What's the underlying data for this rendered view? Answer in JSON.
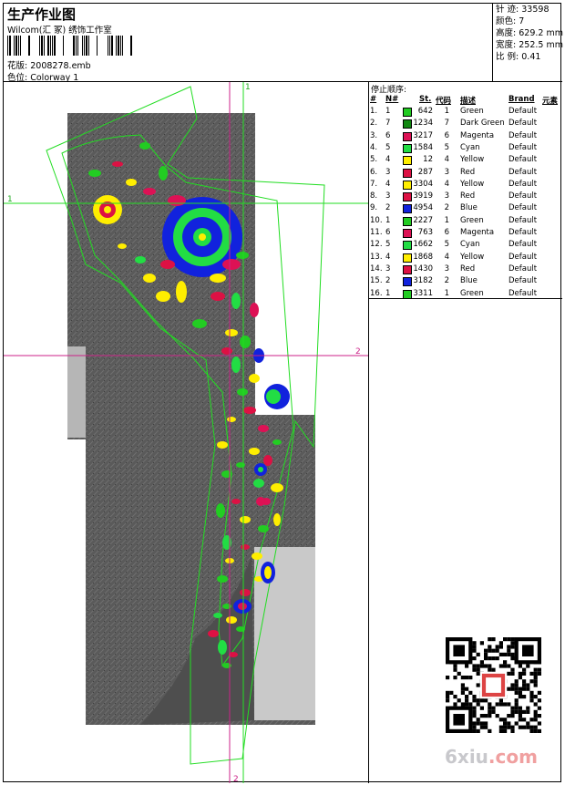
{
  "header": {
    "title": "生产作业图",
    "company": "Wilcom(汇 冢) 绣饰工作室",
    "design_label": "花版:",
    "design_file": "2008278.emb",
    "colorway_label": "色位:",
    "colorway": "Colorway 1"
  },
  "stats": {
    "stitches_label": "针 迹:",
    "stitches": "33598",
    "colors_label": "颜色:",
    "colors": "7",
    "height_label": "高度:",
    "height": "629.2 mm",
    "width_label": "宽度:",
    "width": "252.5 mm",
    "scale_label": "比 例:",
    "scale": "0.41"
  },
  "stop_sequence": {
    "title": "停止顺序:",
    "headers": {
      "num": "#",
      "needle": "N#",
      "stitches": "St.",
      "code": "代码",
      "description": "描述",
      "brand": "Brand",
      "elements": "元素"
    },
    "rows": [
      {
        "num": "1.",
        "needle": "1",
        "color": "#22cc22",
        "stitches": "642",
        "code": "1",
        "description": "Green",
        "brand": "Default"
      },
      {
        "num": "2.",
        "needle": "7",
        "color": "#118811",
        "stitches": "1234",
        "code": "7",
        "description": "Dark Green",
        "brand": "Default"
      },
      {
        "num": "3.",
        "needle": "6",
        "color": "#dd1155",
        "stitches": "3217",
        "code": "6",
        "description": "Magenta",
        "brand": "Default"
      },
      {
        "num": "4.",
        "needle": "5",
        "color": "#22dd44",
        "stitches": "1584",
        "code": "5",
        "description": "Cyan",
        "brand": "Default"
      },
      {
        "num": "5.",
        "needle": "4",
        "color": "#ffee00",
        "stitches": "12",
        "code": "4",
        "description": "Yellow",
        "brand": "Default"
      },
      {
        "num": "6.",
        "needle": "3",
        "color": "#dd1144",
        "stitches": "287",
        "code": "3",
        "description": "Red",
        "brand": "Default"
      },
      {
        "num": "7.",
        "needle": "4",
        "color": "#ffee00",
        "stitches": "3304",
        "code": "4",
        "description": "Yellow",
        "brand": "Default"
      },
      {
        "num": "8.",
        "needle": "3",
        "color": "#dd1144",
        "stitches": "3919",
        "code": "3",
        "description": "Red",
        "brand": "Default"
      },
      {
        "num": "9.",
        "needle": "2",
        "color": "#1122dd",
        "stitches": "4954",
        "code": "2",
        "description": "Blue",
        "brand": "Default"
      },
      {
        "num": "10.",
        "needle": "1",
        "color": "#22cc22",
        "stitches": "2227",
        "code": "1",
        "description": "Green",
        "brand": "Default"
      },
      {
        "num": "11.",
        "needle": "6",
        "color": "#dd1155",
        "stitches": "763",
        "code": "6",
        "description": "Magenta",
        "brand": "Default"
      },
      {
        "num": "12.",
        "needle": "5",
        "color": "#22dd44",
        "stitches": "1662",
        "code": "5",
        "description": "Cyan",
        "brand": "Default"
      },
      {
        "num": "13.",
        "needle": "4",
        "color": "#ffee00",
        "stitches": "1868",
        "code": "4",
        "description": "Yellow",
        "brand": "Default"
      },
      {
        "num": "14.",
        "needle": "3",
        "color": "#dd1144",
        "stitches": "1430",
        "code": "3",
        "description": "Red",
        "brand": "Default"
      },
      {
        "num": "15.",
        "needle": "2",
        "color": "#1122dd",
        "stitches": "3182",
        "code": "2",
        "description": "Blue",
        "brand": "Default"
      },
      {
        "num": "16.",
        "needle": "1",
        "color": "#22cc22",
        "stitches": "3311",
        "code": "1",
        "description": "Green",
        "brand": "Default"
      }
    ]
  },
  "guides": {
    "h1": "1",
    "h2": "2",
    "v1": "1",
    "v2": "2"
  },
  "watermark": {
    "text_a": "6xiu",
    "text_b": ".com"
  }
}
